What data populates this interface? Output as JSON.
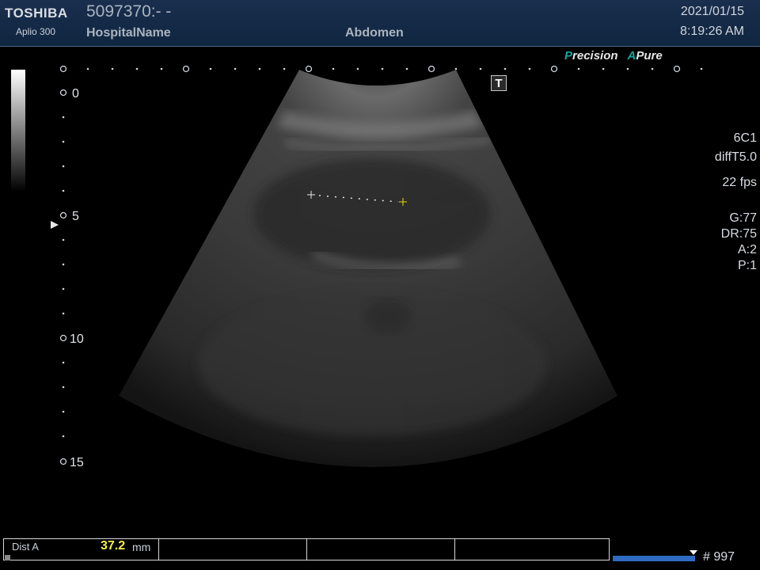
{
  "header": {
    "brand": "TOSHIBA",
    "model": "Aplio 300",
    "patient_id": "5097370:- -",
    "hospital": "HospitalName",
    "preset": "Abdomen",
    "date": "2021/01/15",
    "time": "8:19:26 AM"
  },
  "overlay": {
    "precision_prefix": "P",
    "precision_rest": "recision",
    "apure_prefix": "A",
    "apure_rest": "Pure",
    "t_button": "T"
  },
  "depth_scale": {
    "labels": [
      "0",
      "5",
      "10",
      "15"
    ],
    "unit_max_cm": 15
  },
  "params": {
    "probe": "6C1",
    "mode": "diffT5.0",
    "fps": "22 fps",
    "gain": "G:77",
    "dynamic_range": "DR:75",
    "a": "A:2",
    "p": "P:1"
  },
  "measurement": {
    "label": "Dist A",
    "value": "37.2",
    "unit": "mm"
  },
  "cine": {
    "frame_count": "# 997"
  },
  "colors": {
    "header_bg": "#13294a",
    "accent_teal": "#18a6a0",
    "measure_yellow": "#f3f040",
    "cine_blue": "#2f6bc2"
  }
}
